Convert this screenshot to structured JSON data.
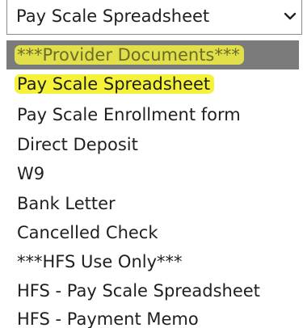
{
  "select": {
    "value": "Pay Scale Spreadsheet",
    "icon": "chevron-down-icon"
  },
  "options": [
    {
      "label": "***Provider Documents***",
      "selected": true,
      "highlighted": true
    },
    {
      "label": "Pay Scale Spreadsheet",
      "selected": false,
      "highlighted": true
    },
    {
      "label": "Pay Scale Enrollment form",
      "selected": false,
      "highlighted": false
    },
    {
      "label": "Direct Deposit",
      "selected": false,
      "highlighted": false
    },
    {
      "label": "W9",
      "selected": false,
      "highlighted": false
    },
    {
      "label": "Bank Letter",
      "selected": false,
      "highlighted": false
    },
    {
      "label": "Cancelled Check",
      "selected": false,
      "highlighted": false
    },
    {
      "label": "***HFS Use Only***",
      "selected": false,
      "highlighted": false
    },
    {
      "label": "HFS - Pay Scale Spreadsheet",
      "selected": false,
      "highlighted": false
    },
    {
      "label": "HFS - Payment Memo",
      "selected": false,
      "highlighted": false
    }
  ],
  "colors": {
    "selected_row": "#7b7b7b",
    "highlighter": "#f5f23a",
    "text": "#1f1f1f"
  }
}
